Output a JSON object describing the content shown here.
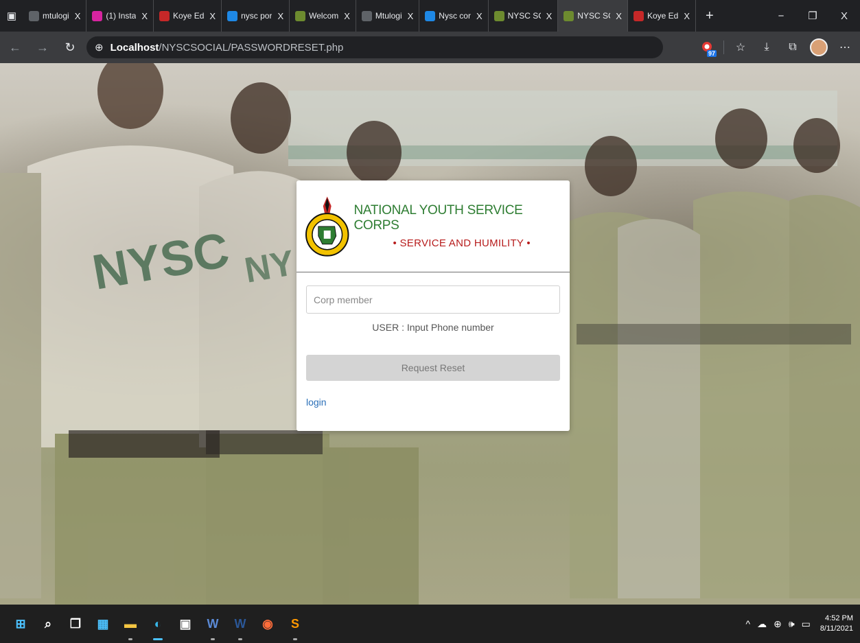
{
  "browser": {
    "tabs": [
      {
        "title": "mtulogi",
        "icon": "document-icon",
        "color": "#5f6368",
        "active": false
      },
      {
        "title": "(1) Insta",
        "icon": "instagram-icon",
        "color": "#d6249f",
        "active": false
      },
      {
        "title": "Koye Ed",
        "icon": "pdf-icon",
        "color": "#c62828",
        "active": false
      },
      {
        "title": "nysc por",
        "icon": "bing-icon",
        "color": "#1e88e5",
        "active": false
      },
      {
        "title": "Welcom",
        "icon": "nysc-icon",
        "color": "#6d8b2f",
        "active": false
      },
      {
        "title": "Mtulogi",
        "icon": "document-icon",
        "color": "#5f6368",
        "active": false
      },
      {
        "title": "Nysc cor",
        "icon": "bing-icon",
        "color": "#1e88e5",
        "active": false
      },
      {
        "title": "NYSC SC",
        "icon": "nysc-icon",
        "color": "#6d8b2f",
        "active": false
      },
      {
        "title": "NYSC SC",
        "icon": "nysc-icon",
        "color": "#6d8b2f",
        "active": true
      },
      {
        "title": "Koye Ed",
        "icon": "pdf-icon",
        "color": "#c62828",
        "active": false
      }
    ],
    "tab_close": "X",
    "new_tab": "+",
    "window_controls": {
      "minimize": "−",
      "restore": "❐",
      "close": "X"
    },
    "address": {
      "host": "Localhost",
      "path": "/NYSCSOCIAL/PASSWORDRESET.php"
    },
    "extension_badge": "97"
  },
  "login_card": {
    "brand_title": "NATIONAL YOUTH SERVICE CORPS",
    "brand_motto": "• SERVICE AND HUMILITY •",
    "phone_placeholder": "Corp member",
    "phone_value": "",
    "hint": "USER : Input Phone number",
    "reset_button": "Request Reset",
    "login_link": "login"
  },
  "taskbar": {
    "time": "4:52 PM",
    "date": "8/11/2021",
    "tray_chevron": "^",
    "apps": [
      {
        "name": "start",
        "glyph": "⊞",
        "color": "#4cc2ff"
      },
      {
        "name": "search",
        "glyph": "⌕",
        "color": "#ffffff"
      },
      {
        "name": "task-view",
        "glyph": "❐",
        "color": "#ffffff"
      },
      {
        "name": "widgets",
        "glyph": "▦",
        "color": "#4cc2ff"
      },
      {
        "name": "file-explorer",
        "glyph": "▬",
        "color": "#f4c542"
      },
      {
        "name": "edge",
        "glyph": "◐",
        "color": "#38b6e8"
      },
      {
        "name": "store",
        "glyph": "▣",
        "color": "#ffffff"
      },
      {
        "name": "word-alt",
        "glyph": "W",
        "color": "#5b8ad6"
      },
      {
        "name": "word",
        "glyph": "W",
        "color": "#2b5797"
      },
      {
        "name": "media",
        "glyph": "◉",
        "color": "#ff6d3b"
      },
      {
        "name": "sublime",
        "glyph": "S",
        "color": "#ff9800"
      }
    ]
  },
  "colors": {
    "brand_green": "#2e7d32",
    "motto_red": "#b71c1c",
    "link_blue": "#2a6fb8"
  }
}
